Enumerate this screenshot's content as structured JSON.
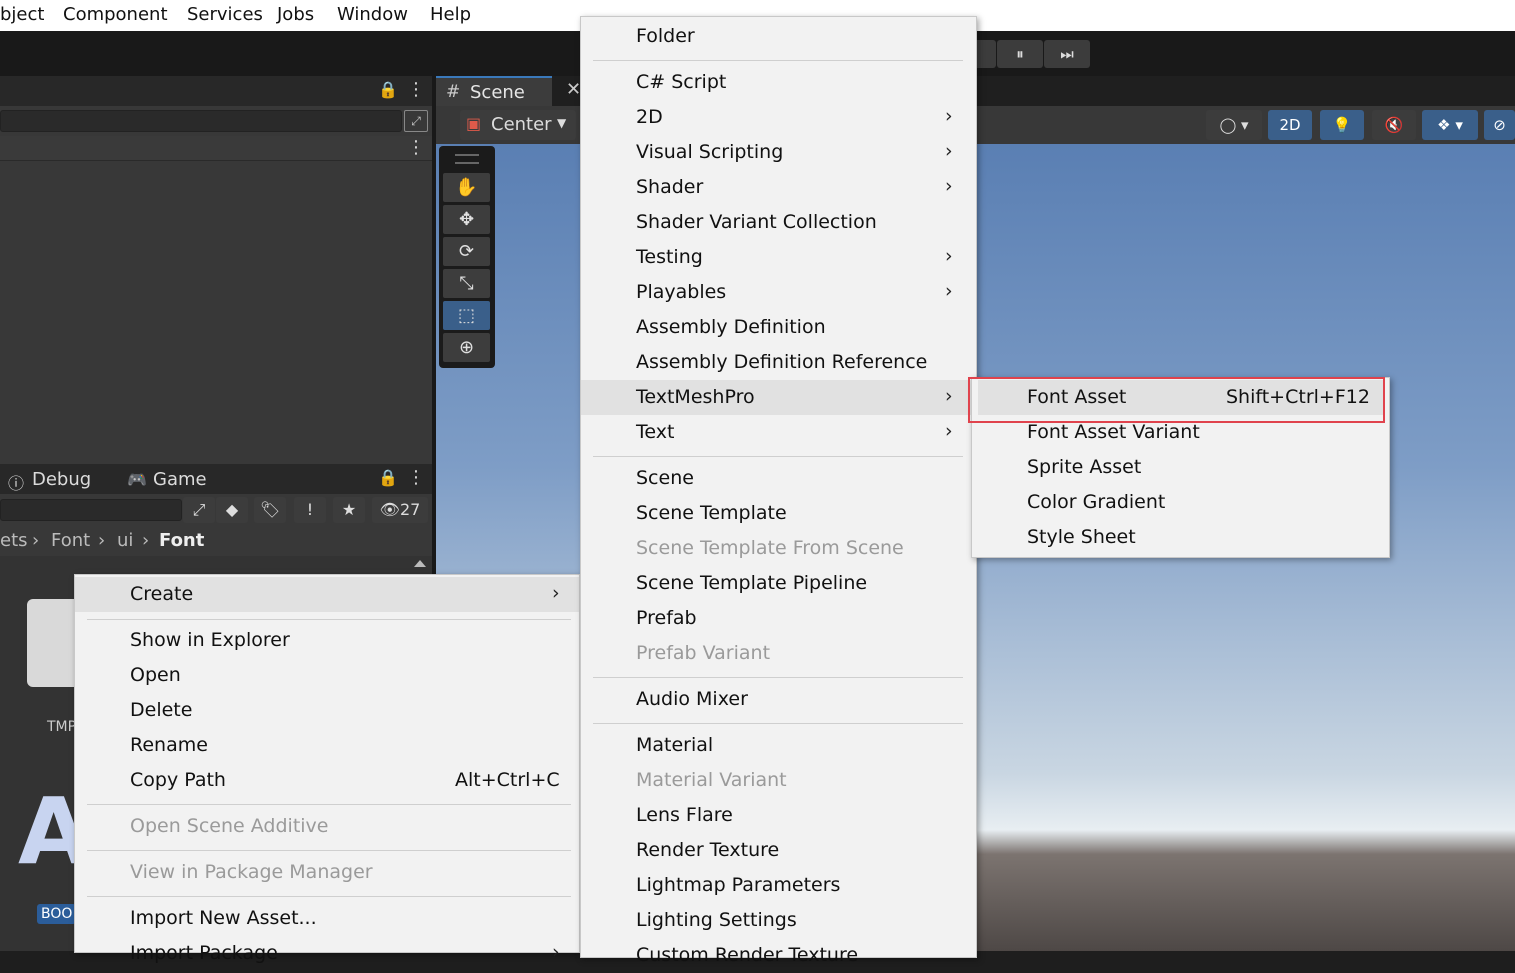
{
  "menubar": {
    "items": [
      "bject",
      "Component",
      "Services",
      "Jobs",
      "Window",
      "Help"
    ]
  },
  "playbar": {
    "pause": "⏸",
    "step": "⏭"
  },
  "hierarchy": {
    "lock": "🔒",
    "more": "⋮"
  },
  "project": {
    "tabs": {
      "debug": "Debug",
      "game": "Game"
    },
    "count": "27",
    "breadcrumb": [
      "ets",
      "Font",
      "ui",
      "Font"
    ],
    "bg_label": "TMP",
    "big_letter": "A",
    "badge": "BOO"
  },
  "scene": {
    "tab": "Scene",
    "pivot": "Center",
    "twod": "2D"
  },
  "context_menu": {
    "items": [
      {
        "label": "Create",
        "arrow": true,
        "highlight": true
      },
      {
        "label": "Show in Explorer"
      },
      {
        "label": "Open"
      },
      {
        "label": "Delete"
      },
      {
        "label": "Rename"
      },
      {
        "label": "Copy Path",
        "shortcut": "Alt+Ctrl+C"
      },
      {
        "label": "Open Scene Additive",
        "disabled": true
      },
      {
        "label": "View in Package Manager",
        "disabled": true
      },
      {
        "label": "Import New Asset..."
      },
      {
        "label": "Import Package",
        "arrow": true
      }
    ]
  },
  "create_menu": {
    "items": [
      {
        "label": "Folder"
      },
      {
        "label": "C# Script"
      },
      {
        "label": "2D",
        "arrow": true
      },
      {
        "label": "Visual Scripting",
        "arrow": true
      },
      {
        "label": "Shader",
        "arrow": true
      },
      {
        "label": "Shader Variant Collection"
      },
      {
        "label": "Testing",
        "arrow": true
      },
      {
        "label": "Playables",
        "arrow": true
      },
      {
        "label": "Assembly Definition"
      },
      {
        "label": "Assembly Definition Reference"
      },
      {
        "label": "TextMeshPro",
        "arrow": true,
        "highlight": true
      },
      {
        "label": "Text",
        "arrow": true
      },
      {
        "label": "Scene"
      },
      {
        "label": "Scene Template"
      },
      {
        "label": "Scene Template From Scene",
        "disabled": true
      },
      {
        "label": "Scene Template Pipeline"
      },
      {
        "label": "Prefab"
      },
      {
        "label": "Prefab Variant",
        "disabled": true
      },
      {
        "label": "Audio Mixer"
      },
      {
        "label": "Material"
      },
      {
        "label": "Material Variant",
        "disabled": true
      },
      {
        "label": "Lens Flare"
      },
      {
        "label": "Render Texture"
      },
      {
        "label": "Lightmap Parameters"
      },
      {
        "label": "Lighting Settings"
      },
      {
        "label": "Custom Render Texture"
      }
    ]
  },
  "tmp_menu": {
    "items": [
      {
        "label": "Font Asset",
        "shortcut": "Shift+Ctrl+F12",
        "highlight": true
      },
      {
        "label": "Font Asset Variant"
      },
      {
        "label": "Sprite Asset"
      },
      {
        "label": "Color Gradient"
      },
      {
        "label": "Style Sheet"
      }
    ]
  },
  "colors": {
    "highlight_box": "#e0434d",
    "accent": "#3a79bb"
  }
}
